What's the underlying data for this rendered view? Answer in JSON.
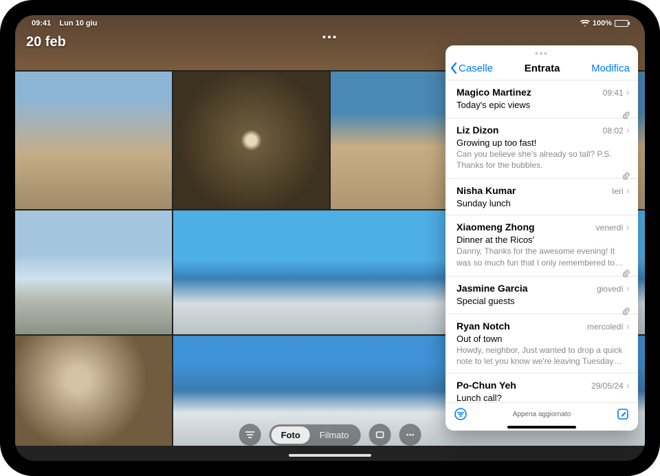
{
  "statusbar": {
    "time": "09:41",
    "date": "Lun 10 giu",
    "battery_pct": "100%"
  },
  "photos": {
    "overlay_date": "20 feb",
    "segment": {
      "photo": "Foto",
      "video": "Filmato"
    }
  },
  "mail": {
    "back_label": "Caselle",
    "title": "Entrata",
    "edit_label": "Modifica",
    "footer_status": "Appena aggiornato",
    "messages": [
      {
        "sender": "Magico Martinez",
        "time": "09:41",
        "subject": "Today's epic views",
        "preview": "",
        "has_attachment": true
      },
      {
        "sender": "Liz Dizon",
        "time": "08:02",
        "subject": "Growing up too fast!",
        "preview": "Can you believe she's already so tall? P.S. Thanks for the bubbles.",
        "has_attachment": true
      },
      {
        "sender": "Nisha Kumar",
        "time": "Ieri",
        "subject": "Sunday lunch",
        "preview": "",
        "has_attachment": false
      },
      {
        "sender": "Xiaomeng Zhong",
        "time": "venerdì",
        "subject": "Dinner at the Ricos'",
        "preview": "Danny, Thanks for the awesome evening! It was so much fun that I only remembered to take on…",
        "has_attachment": true
      },
      {
        "sender": "Jasmine Garcia",
        "time": "giovedì",
        "subject": "Special guests",
        "preview": "",
        "has_attachment": true
      },
      {
        "sender": "Ryan Notch",
        "time": "mercoledì",
        "subject": "Out of town",
        "preview": "Howdy, neighbor, Just wanted to drop a quick note to let you know we're leaving Tuesday an…",
        "has_attachment": false
      },
      {
        "sender": "Po-Chun Yeh",
        "time": "29/05/24",
        "subject": "Lunch call?",
        "preview": "",
        "has_attachment": false
      }
    ]
  }
}
